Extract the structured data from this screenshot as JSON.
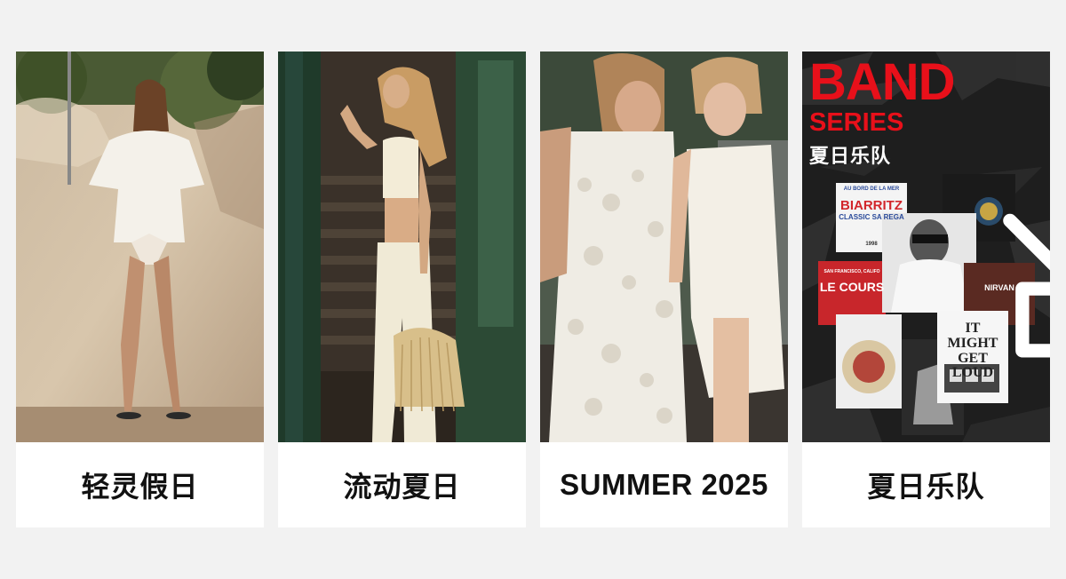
{
  "cards": [
    {
      "caption": "轻灵假日"
    },
    {
      "caption": "流动夏日"
    },
    {
      "caption": "SUMMER 2025"
    },
    {
      "caption": "夏日乐队",
      "promo": {
        "title_line1": "BAND",
        "title_line2": "SERIES",
        "subtitle": "夏日乐队",
        "shirt_biarritz_top": "AU BORD DE LA MER",
        "shirt_biarritz": "BIARRITZ",
        "shirt_biarritz_sub": "CLASSIC SA REGA",
        "shirt_biarritz_year": "1998",
        "shirt_lecour_top": "SAN FRANCISCO, CALIFO",
        "shirt_lecour": "LE COURS",
        "shirt_nirvana": "NIRVAN",
        "shirt_loud": "IT MIGHT GET LOUD"
      }
    }
  ],
  "icons": {
    "sound": "speaker-muted-icon"
  },
  "colors": {
    "background": "#f2f2f2",
    "card": "#ffffff",
    "caption": "#111111",
    "brand_red": "#e8101a"
  }
}
